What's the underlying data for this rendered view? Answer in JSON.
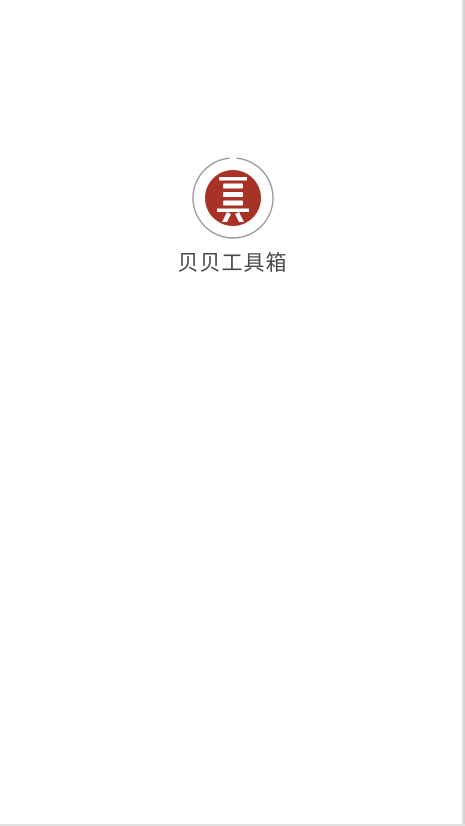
{
  "app": {
    "name": "贝贝工具箱",
    "logo_icon": "bei-character-logo-icon",
    "loading_icon": "loading-ring-icon"
  },
  "colors": {
    "logo_red": "#a93226",
    "ring_gray": "#9a9a9a",
    "text": "#4a4a4a",
    "background": "#ffffff"
  }
}
